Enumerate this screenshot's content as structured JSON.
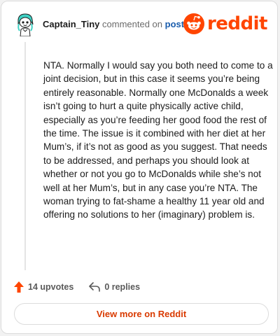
{
  "header": {
    "username": "Captain_Tiny",
    "commented_on": "commented on",
    "post_link": "post",
    "logo_text": "reddit"
  },
  "comment": {
    "text": "NTA. Normally I would say you both need to come to a joint decision, but in this case it seems you’re being entirely reasonable. Normally one McDonalds a week isn’t going to hurt a quite physically active child, especially as you’re feeding her good food the rest of the time. The issue is it combined with her diet at her Mum’s, if it’s not as good as you suggest. That needs to be addressed, and perhaps you should look at whether or not you go to McDonalds while she’s not well at her Mum’s, but in any case you’re NTA. The woman trying to fat-shame a healthy 11 year old and offering no solutions to her (imaginary) problem is."
  },
  "actions": {
    "upvotes": "14 upvotes",
    "replies": "0 replies",
    "upvote_icon": "upvote-arrow-icon",
    "reply_icon": "reply-arrow-icon"
  },
  "footer": {
    "view_more": "View more on Reddit"
  },
  "colors": {
    "brand": "#ff4500",
    "link": "#1a5dad",
    "view_more": "#d93a00"
  }
}
